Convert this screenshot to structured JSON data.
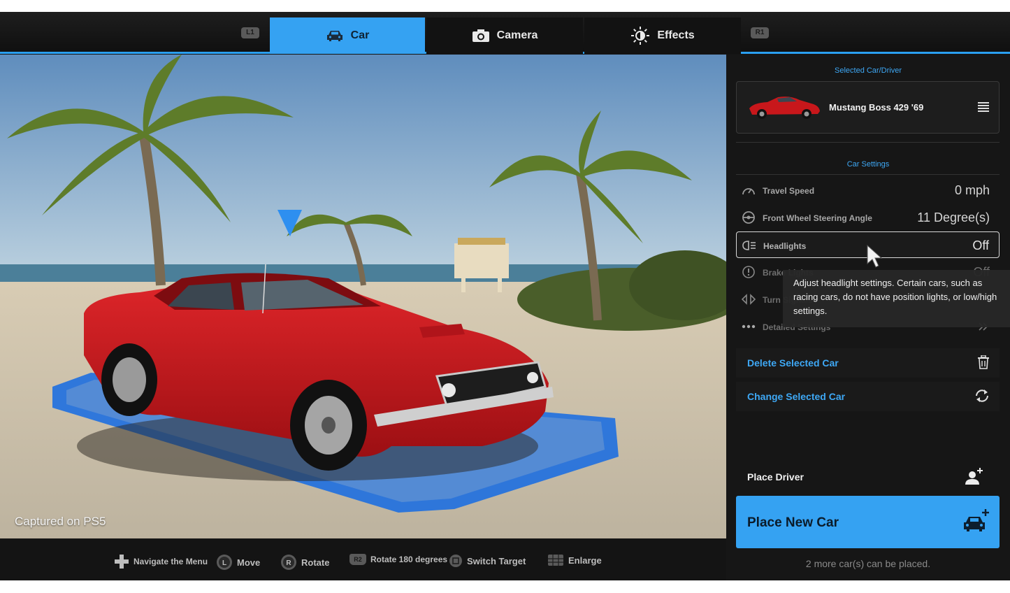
{
  "tabs": {
    "l1": "L1",
    "r1": "R1",
    "car": "Car",
    "camera": "Camera",
    "effects": "Effects"
  },
  "scene": {
    "watermark": "Captured on PS5"
  },
  "panel": {
    "selected_title": "Selected Car/Driver",
    "car_name": "Mustang Boss 429 '69",
    "car_settings_title": "Car Settings",
    "settings": [
      {
        "label": "Travel Speed",
        "value": "0 mph"
      },
      {
        "label": "Front Wheel Steering Angle",
        "value": "11 Degree(s)"
      },
      {
        "label": "Headlights",
        "value": "Off"
      },
      {
        "label": "Brake Lights",
        "value": "Off"
      },
      {
        "label": "Turn Signals",
        "value": ""
      },
      {
        "label": "Detailed Settings",
        "value": ""
      }
    ],
    "tooltip": "Adjust headlight settings. Certain cars, such as racing cars, do not have position lights, or low/high settings.",
    "delete_car": "Delete Selected Car",
    "change_car": "Change Selected Car",
    "place_driver": "Place Driver",
    "place_new_car": "Place New Car",
    "remaining": "2 more car(s) can be placed."
  },
  "hints": {
    "navigate": "Navigate the Menu",
    "move": "Move",
    "rotate": "Rotate",
    "r2": "R2",
    "rotate180": "Rotate 180 degrees",
    "switch_target": "Switch Target",
    "enlarge": "Enlarge",
    "l_stick": "L",
    "r_stick": "R"
  },
  "colors": {
    "accent": "#35a2f2",
    "panel_bg": "#161616",
    "car_red": "#c8171b"
  },
  "icons": {
    "car_tab": "car-icon",
    "camera_tab": "camera-icon",
    "effects_tab": "sun-icon",
    "menu": "hamburger-menu-icon",
    "delete": "trash-icon",
    "change": "swap-arrows-icon",
    "driver": "add-person-icon",
    "new_car": "add-car-icon"
  }
}
